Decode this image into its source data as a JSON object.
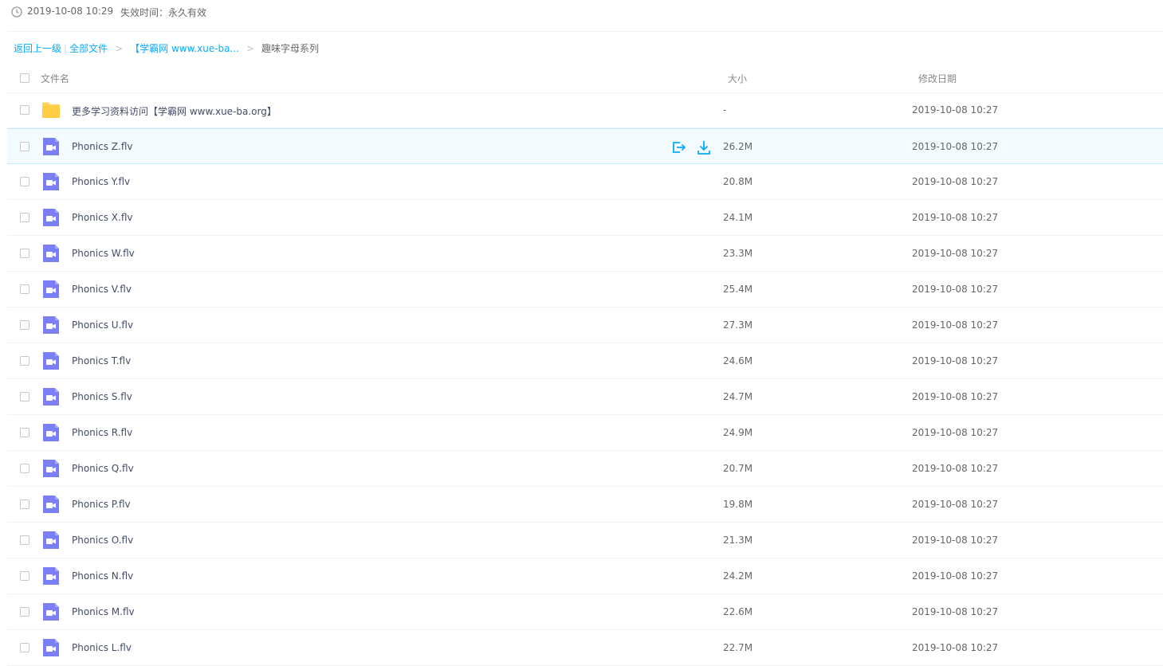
{
  "share_info": {
    "time": "2019-10-08 10:29",
    "expire": "失效时间：永久有效"
  },
  "breadcrumb": {
    "back": "返回上一级",
    "all_files": "全部文件",
    "parent": "【学霸网 www.xue-ba...",
    "current": "趣味字母系列",
    "sep_bar": "|",
    "arrow": ">"
  },
  "header": {
    "name": "文件名",
    "size": "大小",
    "date": "修改日期"
  },
  "colors": {
    "link": "#09aaff",
    "folder": "#ffd25c",
    "video": "#7b7ff5",
    "row_active_bg": "#f4fbff"
  },
  "files": [
    {
      "name": "更多学习资料访问【学霸网 www.xue-ba.org】",
      "size": "-",
      "date": "2019-10-08 10:27",
      "icon": "folder-icon"
    },
    {
      "name": "Phonics Z.flv",
      "size": "26.2M",
      "date": "2019-10-08 10:27",
      "icon": "video-file-icon"
    },
    {
      "name": "Phonics Y.flv",
      "size": "20.8M",
      "date": "2019-10-08 10:27",
      "icon": "video-file-icon"
    },
    {
      "name": "Phonics X.flv",
      "size": "24.1M",
      "date": "2019-10-08 10:27",
      "icon": "video-file-icon"
    },
    {
      "name": "Phonics W.flv",
      "size": "23.3M",
      "date": "2019-10-08 10:27",
      "icon": "video-file-icon"
    },
    {
      "name": "Phonics V.flv",
      "size": "25.4M",
      "date": "2019-10-08 10:27",
      "icon": "video-file-icon"
    },
    {
      "name": "Phonics U.flv",
      "size": "27.3M",
      "date": "2019-10-08 10:27",
      "icon": "video-file-icon"
    },
    {
      "name": "Phonics T.flv",
      "size": "24.6M",
      "date": "2019-10-08 10:27",
      "icon": "video-file-icon"
    },
    {
      "name": "Phonics S.flv",
      "size": "24.7M",
      "date": "2019-10-08 10:27",
      "icon": "video-file-icon"
    },
    {
      "name": "Phonics R.flv",
      "size": "24.9M",
      "date": "2019-10-08 10:27",
      "icon": "video-file-icon"
    },
    {
      "name": "Phonics Q.flv",
      "size": "20.7M",
      "date": "2019-10-08 10:27",
      "icon": "video-file-icon"
    },
    {
      "name": "Phonics P.flv",
      "size": "19.8M",
      "date": "2019-10-08 10:27",
      "icon": "video-file-icon"
    },
    {
      "name": "Phonics O.flv",
      "size": "21.3M",
      "date": "2019-10-08 10:27",
      "icon": "video-file-icon"
    },
    {
      "name": "Phonics N.flv",
      "size": "24.2M",
      "date": "2019-10-08 10:27",
      "icon": "video-file-icon"
    },
    {
      "name": "Phonics M.flv",
      "size": "22.6M",
      "date": "2019-10-08 10:27",
      "icon": "video-file-icon"
    },
    {
      "name": "Phonics L.flv",
      "size": "22.7M",
      "date": "2019-10-08 10:27",
      "icon": "video-file-icon"
    }
  ]
}
